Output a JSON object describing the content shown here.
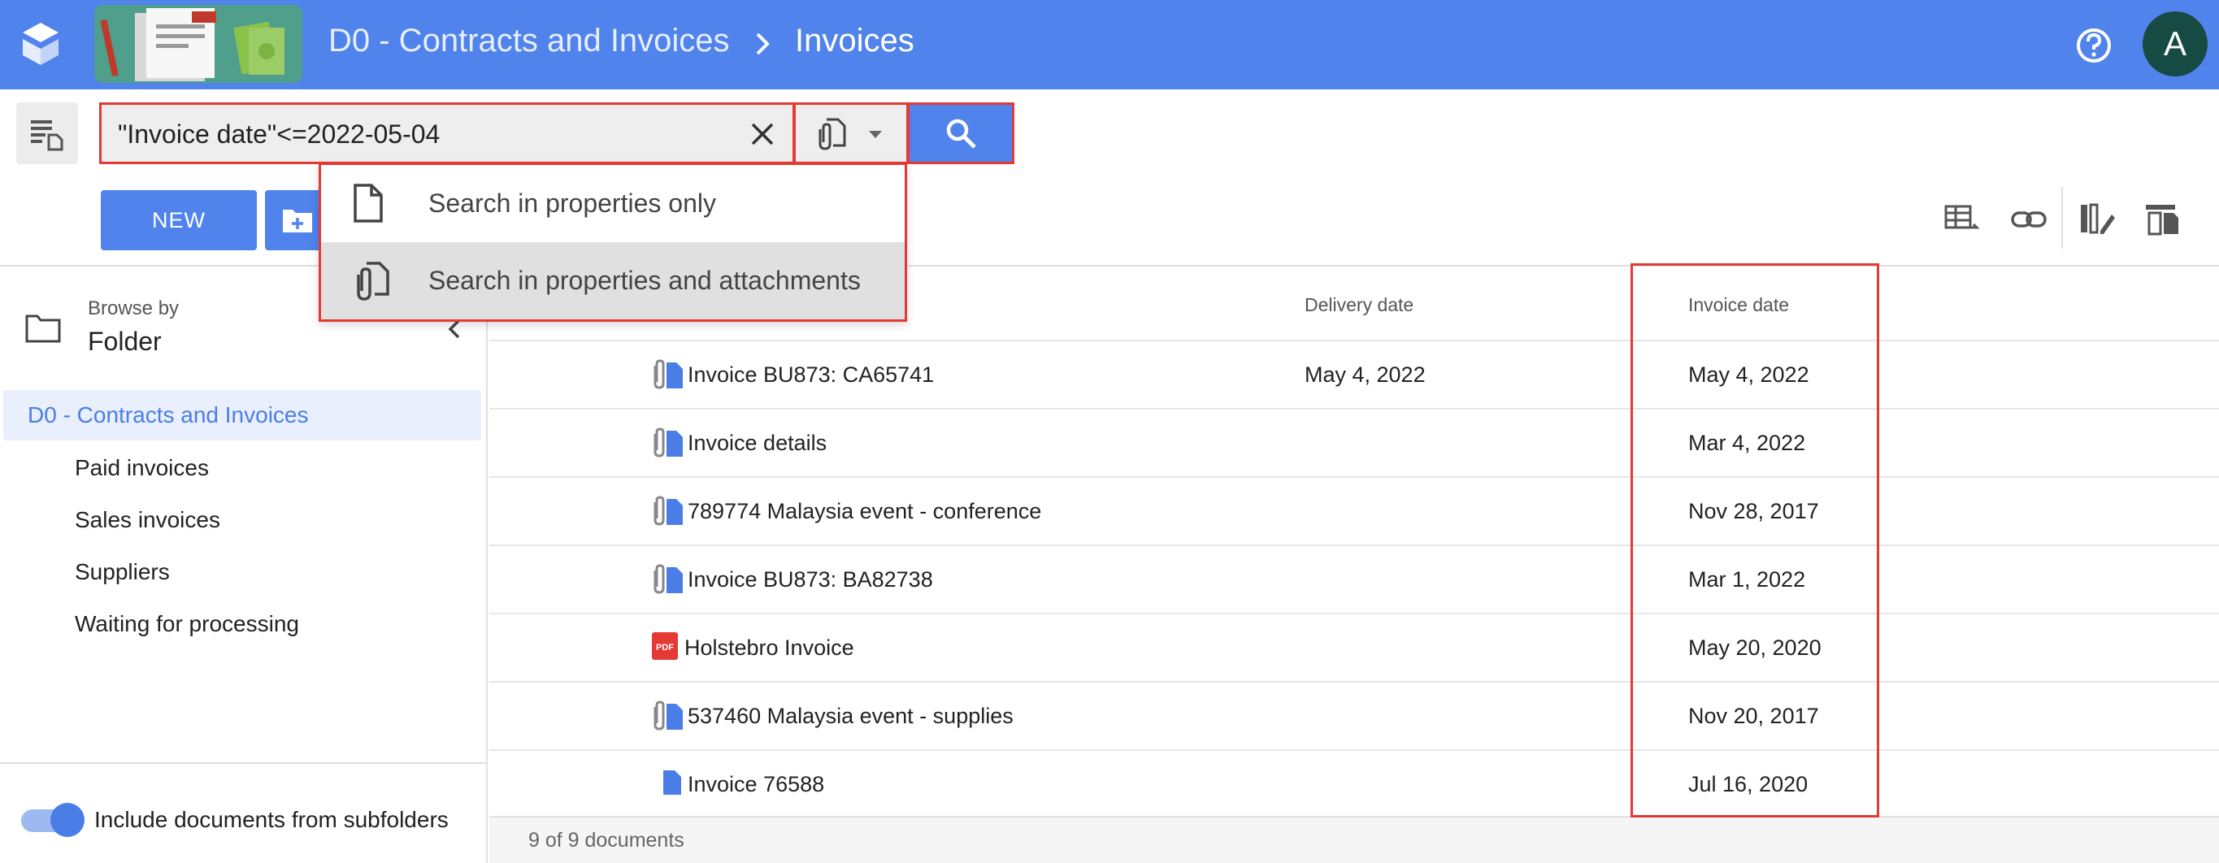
{
  "header": {
    "breadcrumb": [
      "D0 - Contracts and Invoices",
      "Invoices"
    ],
    "avatar_initial": "A",
    "colors": {
      "primary": "#5083ec",
      "avatar": "#174a43",
      "highlight": "#e53935"
    }
  },
  "search": {
    "query": "\"Invoice date\"<=2022-05-04",
    "mode_icon": "attachment-document-icon",
    "options": [
      {
        "label": "Search in properties only",
        "icon": "document-icon",
        "selected": false
      },
      {
        "label": "Search in properties and attachments",
        "icon": "attachment-document-icon",
        "selected": true
      }
    ]
  },
  "toolbar": {
    "new_label": "NEW",
    "icons": [
      "table-export-icon",
      "link-icon",
      "edit-columns-icon",
      "attachment-settings-icon"
    ]
  },
  "sidebar": {
    "browse_by_label": "Browse by",
    "browse_by_value": "Folder",
    "root": "D0 - Contracts and Invoices",
    "items": [
      "Paid invoices",
      "Sales invoices",
      "Suppliers",
      "Waiting for processing"
    ],
    "include_subfolders_label": "Include documents from subfolders",
    "include_subfolders": true
  },
  "table": {
    "columns": {
      "delivery_date": "Delivery date",
      "invoice_date": "Invoice date"
    },
    "rows": [
      {
        "name": "Invoice BU873: CA65741",
        "type": "attachment-doc",
        "delivery_date": "May 4, 2022",
        "invoice_date": "May 4, 2022"
      },
      {
        "name": "Invoice details",
        "type": "attachment-doc",
        "delivery_date": "",
        "invoice_date": "Mar 4, 2022"
      },
      {
        "name": "789774 Malaysia event - conference",
        "type": "attachment-doc",
        "delivery_date": "",
        "invoice_date": "Nov 28, 2017"
      },
      {
        "name": "Invoice BU873: BA82738",
        "type": "attachment-doc",
        "delivery_date": "",
        "invoice_date": "Mar 1, 2022"
      },
      {
        "name": "Holstebro Invoice",
        "type": "pdf",
        "delivery_date": "",
        "invoice_date": "May 20, 2020"
      },
      {
        "name": "537460 Malaysia event - supplies",
        "type": "attachment-doc",
        "delivery_date": "",
        "invoice_date": "Nov 20, 2017"
      },
      {
        "name": "Invoice 76588",
        "type": "doc",
        "delivery_date": "",
        "invoice_date": "Jul 16, 2020"
      }
    ],
    "footer": "9 of 9 documents"
  }
}
